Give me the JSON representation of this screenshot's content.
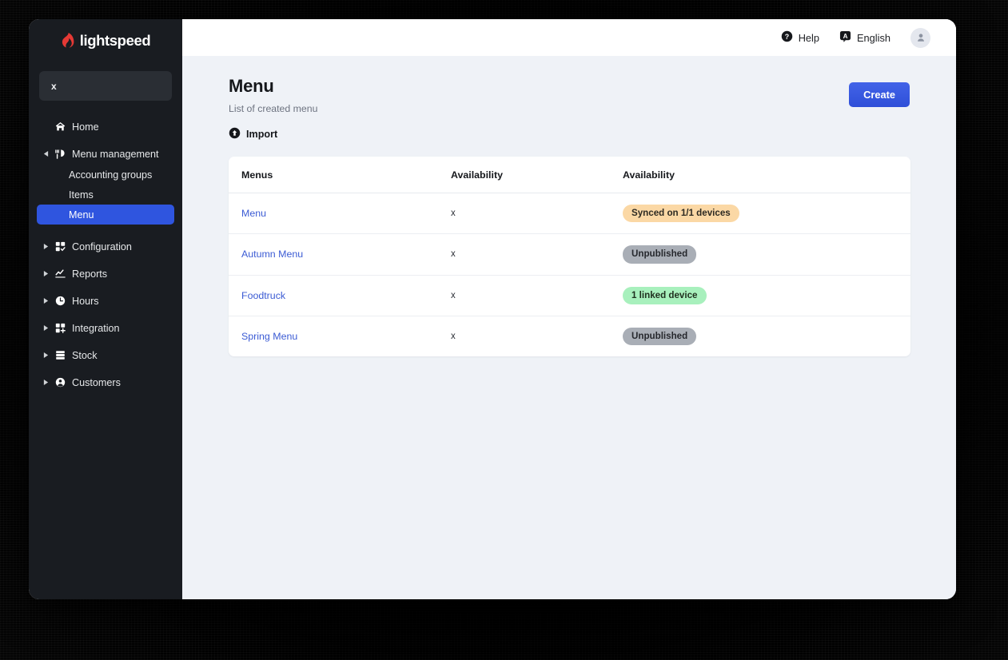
{
  "sidebar": {
    "logo_text": "lightspeed",
    "logo_icon": "lightspeed-flame-icon",
    "picker_value": "x",
    "items": [
      {
        "label": "Home",
        "icon": "home-icon",
        "expandable": false,
        "active": false
      },
      {
        "label": "Menu management",
        "icon": "menu-management-icon",
        "expandable": true,
        "expanded": true,
        "active": false
      },
      {
        "label": "Configuration",
        "icon": "configuration-grid-check-icon",
        "expandable": true,
        "expanded": false,
        "active": false
      },
      {
        "label": "Reports",
        "icon": "reports-chart-icon",
        "expandable": true,
        "expanded": false,
        "active": false
      },
      {
        "label": "Hours",
        "icon": "clock-icon",
        "expandable": true,
        "expanded": false,
        "active": false
      },
      {
        "label": "Integration",
        "icon": "integration-grid-plus-icon",
        "expandable": true,
        "expanded": false,
        "active": false
      },
      {
        "label": "Stock",
        "icon": "stock-boxes-icon",
        "expandable": true,
        "expanded": false,
        "active": false
      },
      {
        "label": "Customers",
        "icon": "customer-person-icon",
        "expandable": true,
        "expanded": false,
        "active": false
      }
    ],
    "subitems": [
      {
        "label": "Accounting groups",
        "active": false
      },
      {
        "label": "Items",
        "active": false
      },
      {
        "label": "Menu",
        "active": true
      }
    ],
    "colors": {
      "background": "#191c21",
      "active": "#2f55df"
    }
  },
  "topbar": {
    "help_label": "Help",
    "help_icon": "help-circle-icon",
    "language_label": "English",
    "language_icon": "translate-icon",
    "avatar_icon": "user-avatar-icon"
  },
  "page": {
    "title": "Menu",
    "subtitle": "List of created menu",
    "import_label": "Import",
    "import_icon": "upload-circle-icon",
    "create_label": "Create",
    "create_color": "#2f4fd8"
  },
  "table": {
    "columns": [
      "Menus",
      "Availability",
      "Availability"
    ],
    "rows": [
      {
        "name": "Menu",
        "availability": "x",
        "status": "Synced on 1/1 devices",
        "status_style": "orange"
      },
      {
        "name": "Autumn Menu",
        "availability": "x",
        "status": "Unpublished",
        "status_style": "gray"
      },
      {
        "name": "Foodtruck",
        "availability": "x",
        "status": "1 linked device",
        "status_style": "green"
      },
      {
        "name": "Spring Menu",
        "availability": "x",
        "status": "Unpublished",
        "status_style": "gray"
      }
    ],
    "badge_colors": {
      "orange": "#fbd8a5",
      "gray": "#a9aeb6",
      "green": "#a8f0bd"
    }
  }
}
